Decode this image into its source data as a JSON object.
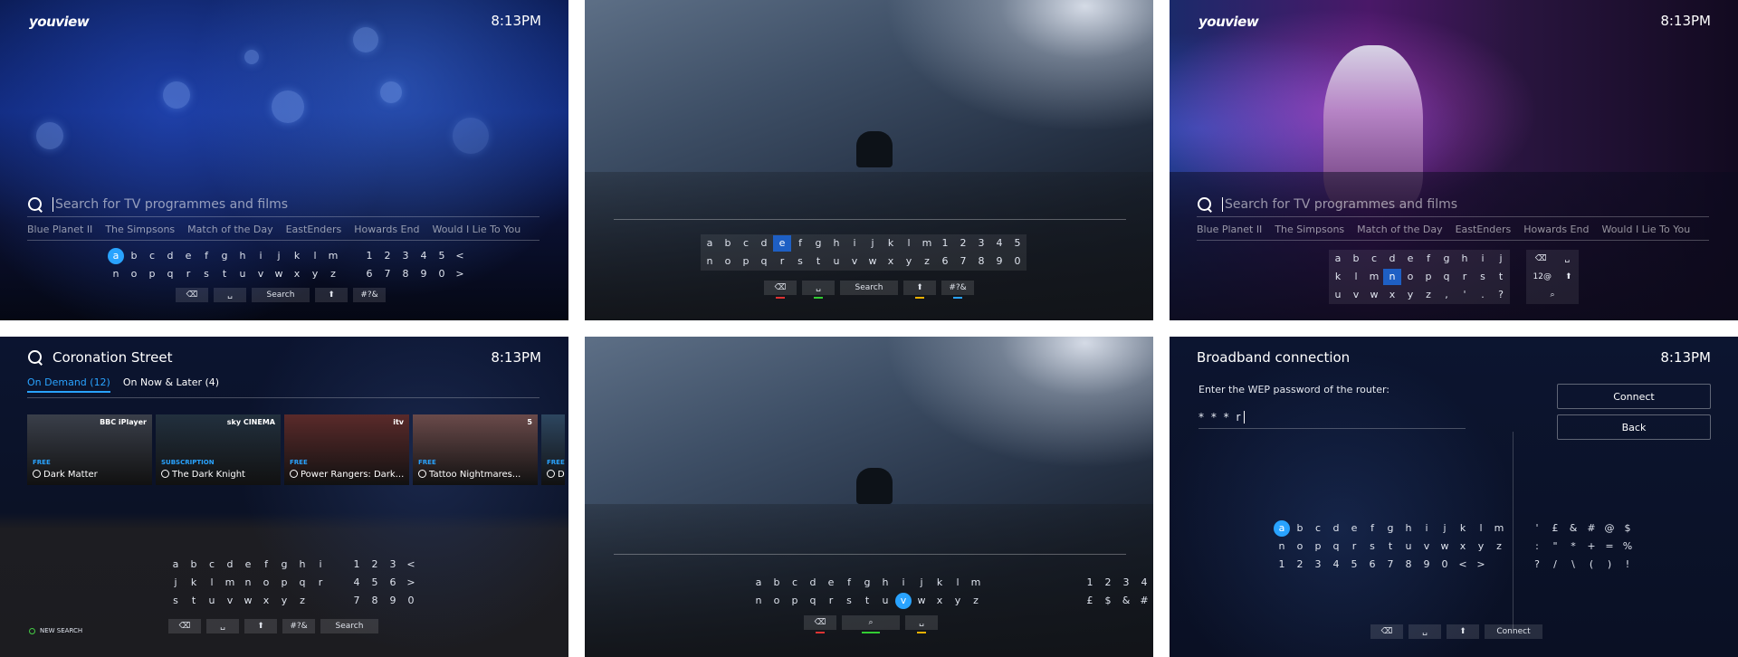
{
  "clock": "8:13PM",
  "logo": "youview",
  "search": {
    "placeholder": "Search for TV programmes and films",
    "suggestions": [
      "Blue Planet II",
      "The Simpsons",
      "Match of the Day",
      "EastEnders",
      "Howards End",
      "Would I Lie To You"
    ]
  },
  "panel1": {
    "row1": [
      "a",
      "b",
      "c",
      "d",
      "e",
      "f",
      "g",
      "h",
      "i",
      "j",
      "k",
      "l",
      "m",
      "",
      "1",
      "2",
      "3",
      "4",
      "5",
      "<"
    ],
    "row2": [
      "n",
      "o",
      "p",
      "q",
      "r",
      "s",
      "t",
      "u",
      "v",
      "w",
      "x",
      "y",
      "z",
      "",
      "6",
      "7",
      "8",
      "9",
      "0",
      ">"
    ],
    "search_btn": "Search",
    "symbols_btn": "#?&"
  },
  "panel2": {
    "row1": [
      "a",
      "b",
      "c",
      "d",
      "e",
      "f",
      "g",
      "h",
      "i",
      "j",
      "k",
      "l",
      "m",
      "1",
      "2",
      "3",
      "4",
      "5"
    ],
    "row2": [
      "n",
      "o",
      "p",
      "q",
      "r",
      "s",
      "t",
      "u",
      "v",
      "w",
      "x",
      "y",
      "z",
      "6",
      "7",
      "8",
      "9",
      "0"
    ],
    "search_btn": "Search",
    "symbols_btn": "#?&"
  },
  "panel3": {
    "row1": [
      "a",
      "b",
      "c",
      "d",
      "e",
      "f",
      "g",
      "h",
      "i",
      "j"
    ],
    "row2": [
      "k",
      "l",
      "m",
      "n",
      "o",
      "p",
      "q",
      "r",
      "s",
      "t"
    ],
    "row3": [
      "u",
      "v",
      "w",
      "x",
      "y",
      "z",
      ",",
      "'",
      ".",
      "?"
    ],
    "numbers_btn": "12@"
  },
  "panel4": {
    "query": "Coronation Street",
    "tabs": [
      "On Demand (12)",
      "On Now & Later (4)"
    ],
    "tiles": [
      {
        "badge": "FREE",
        "title": "Dark Matter",
        "channel": "BBC iPlayer",
        "color": "#3a3f4a"
      },
      {
        "badge": "SUBSCRIPTION",
        "title": "The Dark Knight",
        "channel": "sky CINEMA",
        "color": "#22303e"
      },
      {
        "badge": "FREE",
        "title": "Power Rangers: Dark...",
        "channel": "itv",
        "color": "#5a2a2a"
      },
      {
        "badge": "FREE",
        "title": "Tattoo Nightmares...",
        "channel": "5",
        "color": "#6a4a4a"
      },
      {
        "badge": "FREE",
        "title": "Da",
        "channel": "",
        "color": "#2d4660"
      }
    ],
    "row1": [
      "a",
      "b",
      "c",
      "d",
      "e",
      "f",
      "g",
      "h",
      "i",
      "",
      "1",
      "2",
      "3",
      "<"
    ],
    "row2": [
      "j",
      "k",
      "l",
      "m",
      "n",
      "o",
      "p",
      "q",
      "r",
      "",
      "4",
      "5",
      "6",
      ">"
    ],
    "row3": [
      "s",
      "t",
      "u",
      "v",
      "w",
      "x",
      "y",
      "z",
      "",
      "",
      "7",
      "8",
      "9",
      "0"
    ],
    "symbols_btn": "#?&",
    "search_btn": "Search",
    "new_search": "NEW SEARCH"
  },
  "panel5": {
    "row1": [
      "a",
      "b",
      "c",
      "d",
      "e",
      "f",
      "g",
      "h",
      "i",
      "j",
      "k",
      "l",
      "m"
    ],
    "row2": [
      "n",
      "o",
      "p",
      "q",
      "r",
      "s",
      "t",
      "u",
      "v",
      "w",
      "x",
      "y",
      "z"
    ],
    "num_row1": [
      "1",
      "2",
      "3",
      "4"
    ],
    "num_row2": [
      "£",
      "$",
      "&",
      "#"
    ]
  },
  "panel6": {
    "title": "Broadband connection",
    "prompt": "Enter the WEP password of the router:",
    "password": "* * * r",
    "connect": "Connect",
    "back": "Back",
    "row1": [
      "a",
      "b",
      "c",
      "d",
      "e",
      "f",
      "g",
      "h",
      "i",
      "j",
      "k",
      "l",
      "m"
    ],
    "row2": [
      "n",
      "o",
      "p",
      "q",
      "r",
      "s",
      "t",
      "u",
      "v",
      "w",
      "x",
      "y",
      "z"
    ],
    "row3": [
      "1",
      "2",
      "3",
      "4",
      "5",
      "6",
      "7",
      "8",
      "9",
      "0",
      "<",
      ">"
    ],
    "sym1": [
      "'",
      "£",
      "&",
      "#",
      "@",
      "$"
    ],
    "sym2": [
      ":",
      "\"",
      "*",
      "+",
      "=",
      "%"
    ],
    "sym3": [
      "?",
      "/",
      "\\",
      "(",
      ")",
      "!"
    ],
    "connect_btn": "Connect"
  }
}
